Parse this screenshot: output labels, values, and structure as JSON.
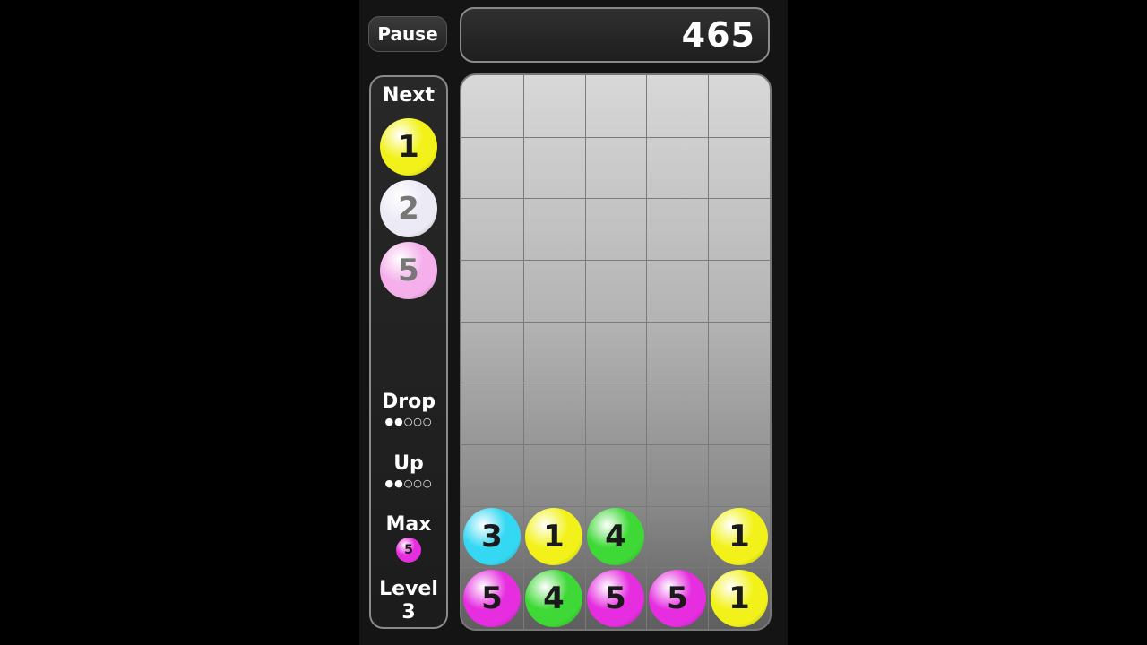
{
  "header": {
    "pause_label": "Pause",
    "score": "465"
  },
  "sidebar": {
    "next_label": "Next",
    "next_queue": [
      {
        "value": "1",
        "color": "#f2f21a"
      },
      {
        "value": "2",
        "color": "#ecebf5"
      },
      {
        "value": "5",
        "color": "#f5b0ec"
      }
    ],
    "drop_label": "Drop",
    "drop_dots": "●●○○○",
    "drop_progress": 0.4,
    "up_label": "Up",
    "up_dots": "●●○○○",
    "up_progress": 0.4,
    "max_label": "Max",
    "max_ball": {
      "value": "5",
      "color": "#e62ee0"
    },
    "level_label": "Level",
    "level_value": "3"
  },
  "board": {
    "columns": 5,
    "rows": 9,
    "balls": [
      {
        "row": 7,
        "col": 0,
        "value": "3",
        "color": "#35d8f2"
      },
      {
        "row": 7,
        "col": 1,
        "value": "1",
        "color": "#f2f21a"
      },
      {
        "row": 7,
        "col": 2,
        "value": "4",
        "color": "#3ed936"
      },
      {
        "row": 7,
        "col": 4,
        "value": "1",
        "color": "#f2f21a"
      },
      {
        "row": 8,
        "col": 0,
        "value": "5",
        "color": "#e62ee0"
      },
      {
        "row": 8,
        "col": 1,
        "value": "4",
        "color": "#3ed936"
      },
      {
        "row": 8,
        "col": 2,
        "value": "5",
        "color": "#e62ee0"
      },
      {
        "row": 8,
        "col": 3,
        "value": "5",
        "color": "#e62ee0"
      },
      {
        "row": 8,
        "col": 4,
        "value": "1",
        "color": "#f2f21a"
      }
    ]
  }
}
